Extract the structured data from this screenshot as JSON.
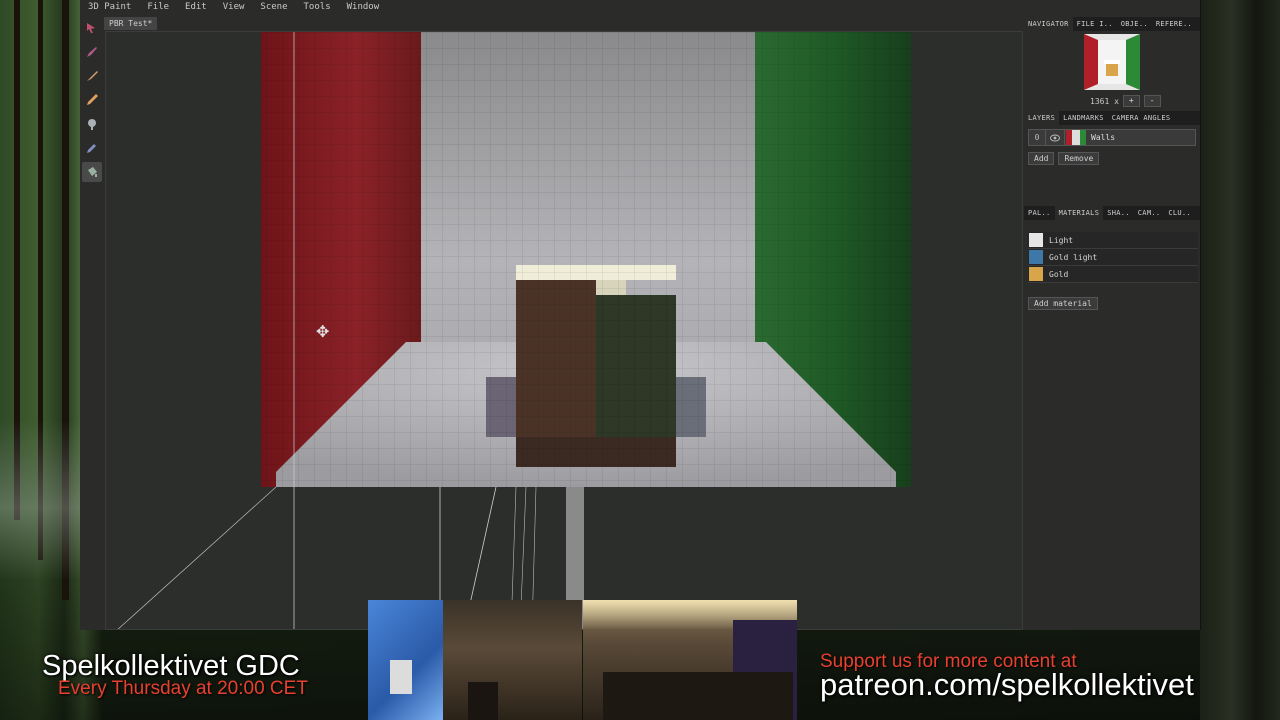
{
  "menu": [
    "3D Paint",
    "File",
    "Edit",
    "View",
    "Scene",
    "Tools",
    "Window"
  ],
  "document_tab": "PBR Test*",
  "tools": [
    "select-arrow-icon",
    "pen-icon",
    "brush-icon",
    "pencil-icon",
    "smudge-icon",
    "eyedropper-icon",
    "fill-bucket-icon"
  ],
  "navigator": {
    "tabs": [
      "NAVIGATOR",
      "FILE I..",
      "OBJE..",
      "REFERE.."
    ],
    "zoom": "1361 x",
    "zoom_in": "+",
    "zoom_out": "-"
  },
  "layers": {
    "tabs": [
      "LAYERS",
      "LANDMARKS",
      "CAMERA ANGLES"
    ],
    "items": [
      {
        "index": "0",
        "name": "Walls"
      }
    ],
    "add_label": "Add",
    "remove_label": "Remove"
  },
  "materials": {
    "tabs": [
      "PAL..",
      "MATERIALS",
      "SHA..",
      "CAM..",
      "CLU.."
    ],
    "list": [
      {
        "name": "Light",
        "color": "#e6e6e6"
      },
      {
        "name": "Gold light",
        "color": "#3d78a8"
      },
      {
        "name": "Gold",
        "color": "#d9a54a"
      }
    ],
    "add_label": "Add material"
  },
  "colors": {
    "red_wall": "#7e1e22",
    "green_wall": "#1f5a26",
    "accent_red": "#e8402f"
  },
  "overlay": {
    "title": "Spelkollektivet GDC",
    "subtitle": "Every Thursday at 20:00 CET",
    "support": "Support us for more content at",
    "patreon": "patreon.com/spelkollektivet"
  }
}
